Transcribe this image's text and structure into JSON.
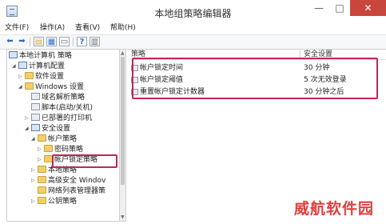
{
  "window": {
    "title": "本地组策略编辑器",
    "min_icon": "minimize-icon",
    "max_icon": "maximize-icon",
    "close_icon": "close-icon"
  },
  "menu": [
    {
      "label": "文件(F)"
    },
    {
      "label": "操作(A)"
    },
    {
      "label": "查看(V)"
    },
    {
      "label": "帮助(H)"
    }
  ],
  "toolbar": {
    "icons": [
      "back-arrow-icon",
      "forward-arrow-icon",
      "up-folder-icon",
      "show-hide-tree-icon",
      "properties-icon",
      "help-icon",
      "filter-icon"
    ]
  },
  "tree": {
    "items": [
      {
        "label": "本地计算机 策略"
      },
      {
        "label": "计算机配置"
      },
      {
        "label": "软件设置"
      },
      {
        "label": "Windows 设置"
      },
      {
        "label": "域名解析策略"
      },
      {
        "label": "脚本(启动/关机)"
      },
      {
        "label": "已部署的打印机"
      },
      {
        "label": "安全设置"
      },
      {
        "label": "帐户策略"
      },
      {
        "label": "密码策略"
      },
      {
        "label": "帐户锁定策略"
      },
      {
        "label": "本地策略"
      },
      {
        "label": "高级安全 Windov"
      },
      {
        "label": "网络列表管理器策"
      },
      {
        "label": "公钥策略"
      }
    ]
  },
  "table": {
    "headers": {
      "policy": "策略",
      "setting": "安全设置"
    },
    "rows": [
      {
        "policy": "帐户锁定时间",
        "setting": "30 分钟"
      },
      {
        "policy": "帐户锁定阈值",
        "setting": "5 次无效登录"
      },
      {
        "policy": "重置帐户锁定计数器",
        "setting": "30 分钟之后"
      }
    ]
  },
  "watermark": "威航软件园",
  "colors": {
    "highlight": "#c6245c",
    "watermark": "#e04040",
    "close": "#c9463d"
  }
}
